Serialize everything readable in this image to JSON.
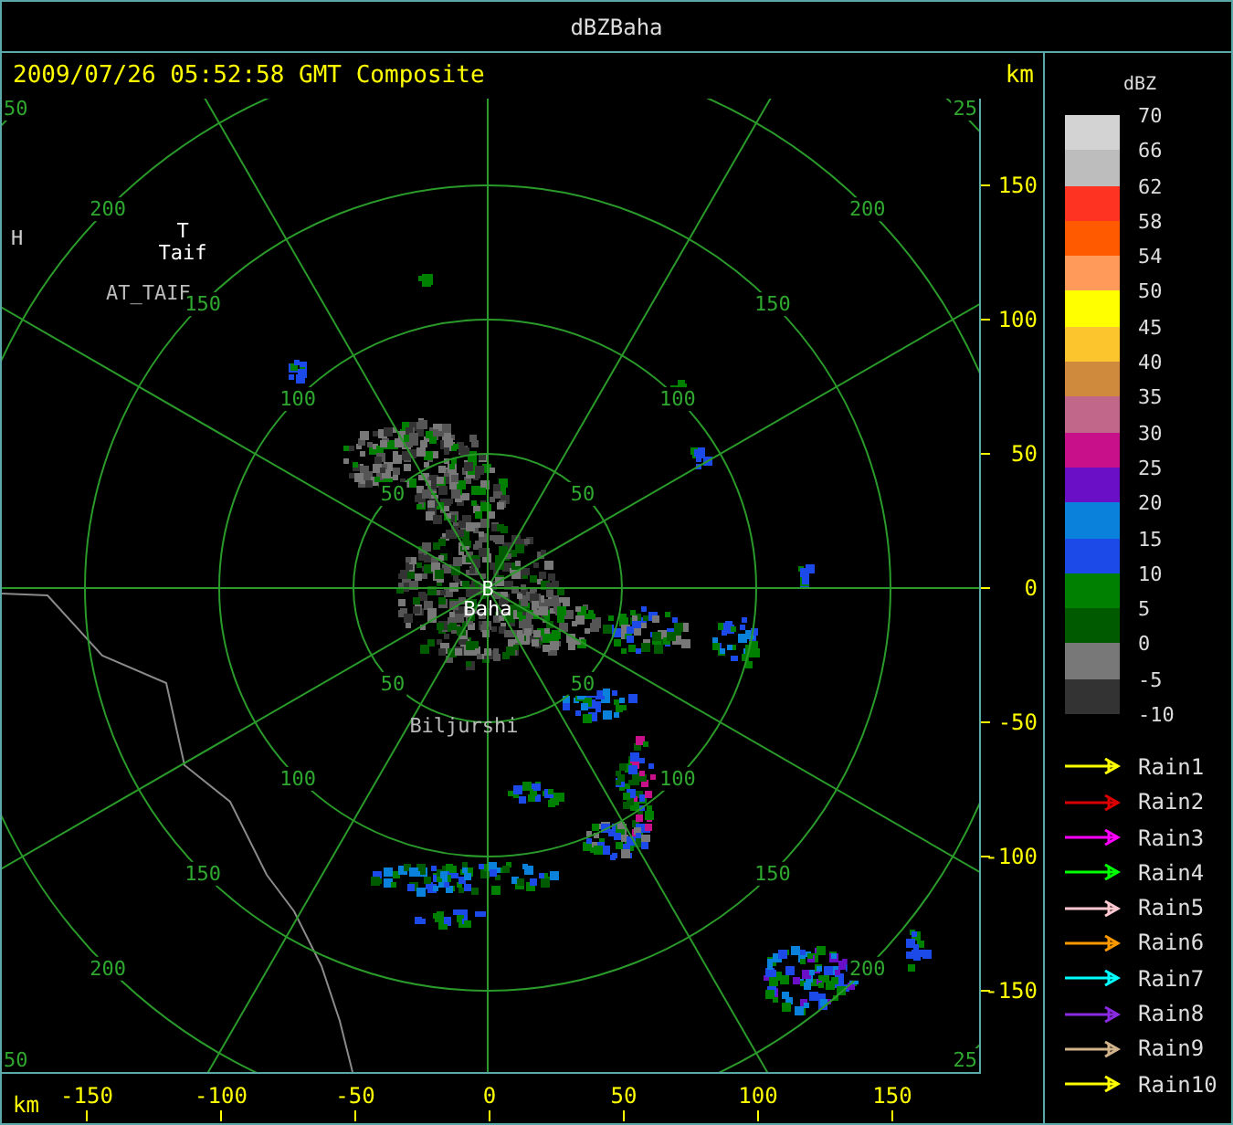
{
  "window": {
    "title": "dBZBaha"
  },
  "header": {
    "timestamp": "2009/07/26 05:52:58 GMT Composite",
    "unit": "km"
  },
  "map_labels": [
    "H",
    "T",
    "Taif",
    "AT_TAIF",
    "B",
    "Baha",
    "Biljurshi"
  ],
  "ring_label_quadrants": [
    {
      "labels": [
        "50",
        "100",
        "150",
        "200",
        "50"
      ]
    },
    {
      "labels": [
        "50",
        "100",
        "150",
        "200",
        "25"
      ]
    },
    {
      "labels": [
        "50",
        "100",
        "150",
        "200",
        "50"
      ]
    },
    {
      "labels": [
        "50",
        "100",
        "150",
        "200",
        "25"
      ]
    }
  ],
  "y_axis": {
    "ticks": [
      "150",
      "100",
      "50",
      "0",
      "-50",
      "-100",
      "-150"
    ]
  },
  "x_axis": {
    "unit": "km",
    "ticks": [
      "-150",
      "-100",
      "-50",
      "0",
      "50",
      "100",
      "150"
    ]
  },
  "dbz_scale": {
    "title": "dBZ",
    "bins": [
      {
        "color": "#d3d3d3"
      },
      {
        "color": "#bdbdbd"
      },
      {
        "color": "#ff3322"
      },
      {
        "color": "#ff5a00"
      },
      {
        "color": "#ff9a5a"
      },
      {
        "color": "#ffff00"
      },
      {
        "color": "#fcc52e"
      },
      {
        "color": "#cf8a3e"
      },
      {
        "color": "#c0678a"
      },
      {
        "color": "#c8108a"
      },
      {
        "color": "#6b0fc7"
      },
      {
        "color": "#0a82dc"
      },
      {
        "color": "#1c4ae8"
      },
      {
        "color": "#008000"
      },
      {
        "color": "#005a00"
      },
      {
        "color": "#787878"
      },
      {
        "color": "#333333"
      }
    ],
    "labels": [
      "70",
      "66",
      "62",
      "58",
      "54",
      "50",
      "45",
      "40",
      "35",
      "30",
      "25",
      "20",
      "15",
      "10",
      "5",
      "0",
      "-5",
      "-10"
    ]
  },
  "rain_legend": [
    {
      "label": "Rain1",
      "color": "#ffff00"
    },
    {
      "label": "Rain2",
      "color": "#dd0000"
    },
    {
      "label": "Rain3",
      "color": "#ff00ff"
    },
    {
      "label": "Rain4",
      "color": "#00ff00"
    },
    {
      "label": "Rain5",
      "color": "#ffc8d0"
    },
    {
      "label": "Rain6",
      "color": "#ff9900"
    },
    {
      "label": "Rain7",
      "color": "#00ffff"
    },
    {
      "label": "Rain8",
      "color": "#8a2be2"
    },
    {
      "label": "Rain9",
      "color": "#d2b48c"
    },
    {
      "label": "Rain10",
      "color": "#ffff00"
    }
  ]
}
